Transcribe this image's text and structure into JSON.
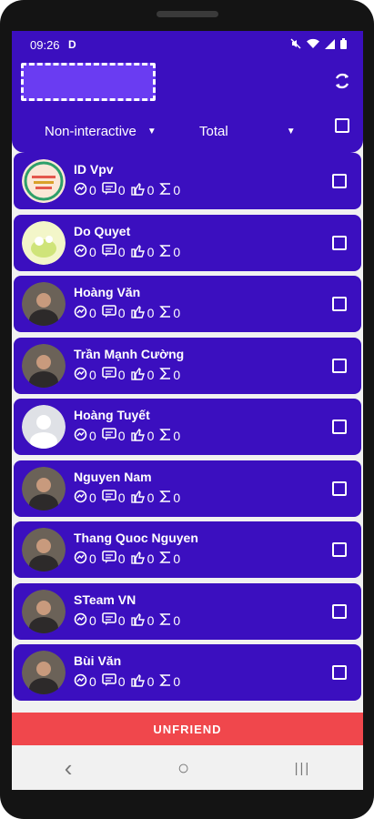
{
  "status_bar": {
    "time": "09:26",
    "indicator": "D",
    "icons": [
      "mute-icon",
      "wifi-icon",
      "signal-icon",
      "battery-icon"
    ]
  },
  "header": {
    "filter_1": "Non-interactive",
    "filter_2": "Total"
  },
  "friends": [
    {
      "name": "ID Vpv",
      "messages": "0",
      "comments": "0",
      "likes": "0",
      "total": "0",
      "avatar": "flowers"
    },
    {
      "name": "Do Quyet",
      "messages": "0",
      "comments": "0",
      "likes": "0",
      "total": "0",
      "avatar": "cartoon"
    },
    {
      "name": "Hoàng Văn",
      "messages": "0",
      "comments": "0",
      "likes": "0",
      "total": "0",
      "avatar": "photo"
    },
    {
      "name": "Trần Mạnh Cường",
      "messages": "0",
      "comments": "0",
      "likes": "0",
      "total": "0",
      "avatar": "photo"
    },
    {
      "name": "Hoàng Tuyết",
      "messages": "0",
      "comments": "0",
      "likes": "0",
      "total": "0",
      "avatar": "default"
    },
    {
      "name": "Nguyen Nam",
      "messages": "0",
      "comments": "0",
      "likes": "0",
      "total": "0",
      "avatar": "photo"
    },
    {
      "name": "Thang Quoc Nguyen",
      "messages": "0",
      "comments": "0",
      "likes": "0",
      "total": "0",
      "avatar": "photo"
    },
    {
      "name": "STeam VN",
      "messages": "0",
      "comments": "0",
      "likes": "0",
      "total": "0",
      "avatar": "photo"
    },
    {
      "name": "Bùi Văn",
      "messages": "0",
      "comments": "0",
      "likes": "0",
      "total": "0",
      "avatar": "photo"
    }
  ],
  "actions": {
    "unfriend_label": "UNFRIEND"
  },
  "nav": {
    "back": "‹",
    "home": "○",
    "recents": "|||"
  },
  "colors": {
    "primary": "#3b0fbf",
    "danger": "#f0474c"
  }
}
